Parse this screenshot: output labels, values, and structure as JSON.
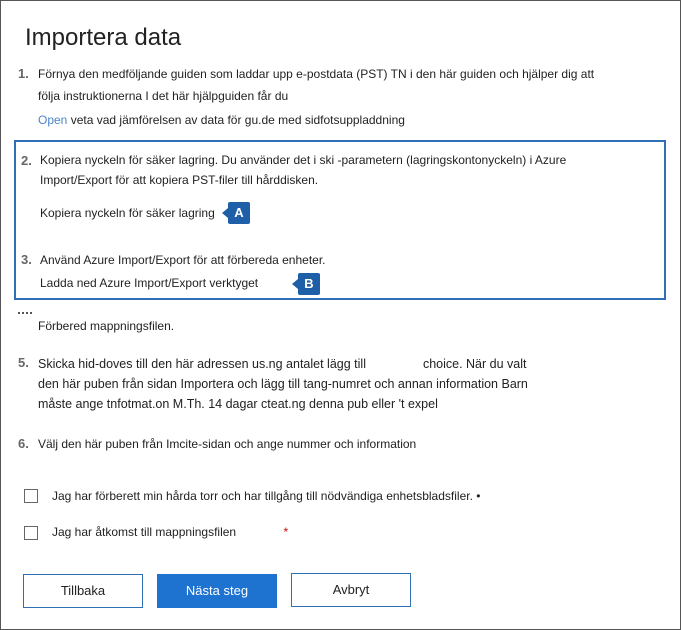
{
  "title": "Importera data",
  "steps": [
    {
      "number": "1.",
      "line1": "Förnya den medföljande guiden som laddar upp e-postdata (PST) TN i den här guiden och hjälper dig att",
      "line2": "följa instruktionerna I det här hjälpguiden får du",
      "link": "Open",
      "line3": "veta vad jämförelsen av data för gu.de med sidfotsuppladdning"
    },
    {
      "number": "2.",
      "line1": "Kopiera nyckeln för säker lagring. Du använder det i ski -parametern (lagringskontonyckeln) i Azure",
      "line2": "Import/Export för att kopiera PST-filer till hårddisken.",
      "action": "Kopiera nyckeln för säker lagring",
      "callout": "A"
    },
    {
      "number": "3.",
      "line1": "Använd Azure Import/Export för att förbereda enheter.",
      "action": "Ladda ned Azure Import/Export verktyget",
      "callout": "B"
    },
    {
      "line1": "Förbered mappningsfilen."
    },
    {
      "number": "5.",
      "line1a": "Skicka hid-doves till den här adressen us.ng antalet lägg till",
      "line1b": "choice. När du valt",
      "line2": "den här puben från sidan Importera och lägg till tang-numret och annan information Barn",
      "line3": "måste ange tnfotmat.on M.Th. 14 dagar cteat.ng denna pub eller 't expel"
    },
    {
      "number": "6.",
      "line1": "Välj den här puben från Imcite-sidan och ange nummer och information"
    }
  ],
  "checks": [
    {
      "label": "Jag har förberett min hårda torr och har tillgång till nödvändiga enhetsbladsfiler.",
      "marker": "•"
    },
    {
      "label": "Jag har åtkomst till mappningsfilen",
      "marker": "*"
    }
  ],
  "buttons": {
    "back": "Tillbaka",
    "next": "Nästa steg",
    "cancel": "Avbryt"
  }
}
